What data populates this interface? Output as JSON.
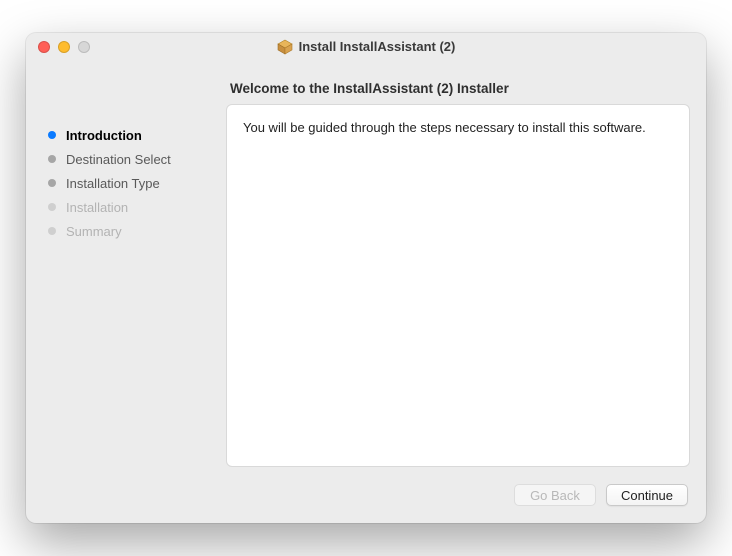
{
  "window": {
    "title": "Install InstallAssistant (2)"
  },
  "heading": "Welcome to the InstallAssistant (2) Installer",
  "body_text": "You will be guided through the steps necessary to install this software.",
  "steps": [
    {
      "label": "Introduction",
      "state": "active"
    },
    {
      "label": "Destination Select",
      "state": "normal"
    },
    {
      "label": "Installation Type",
      "state": "normal"
    },
    {
      "label": "Installation",
      "state": "dim"
    },
    {
      "label": "Summary",
      "state": "dim"
    }
  ],
  "buttons": {
    "go_back": "Go Back",
    "continue": "Continue"
  }
}
